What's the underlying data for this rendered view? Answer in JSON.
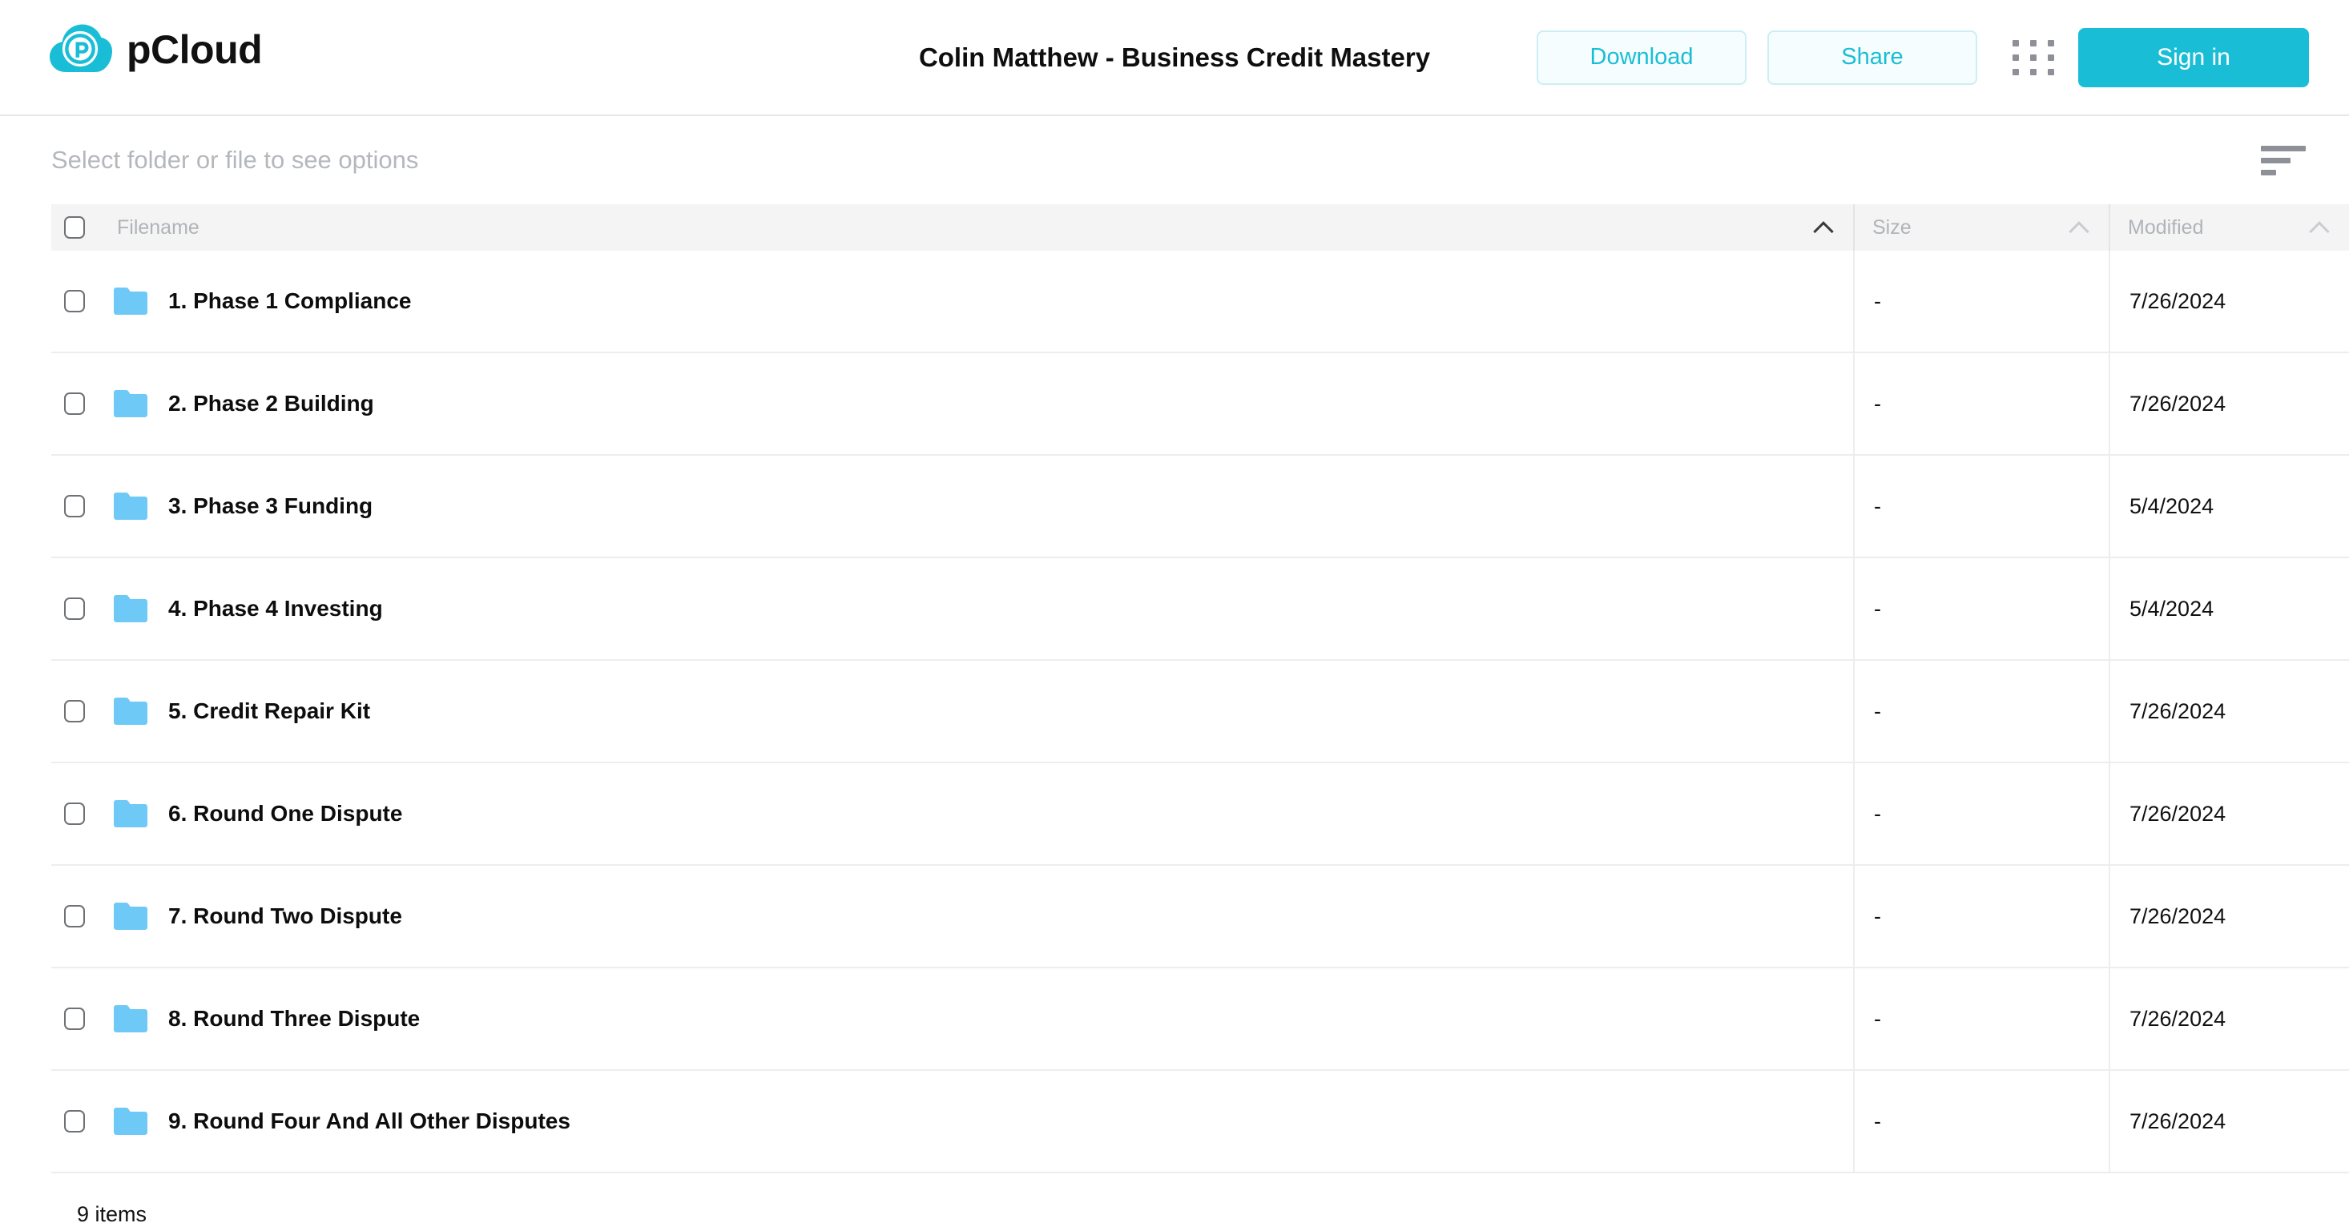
{
  "header": {
    "brand_name": "pCloud",
    "brand_logo_icon": "pcloud-cloud-logo",
    "document_title": "Colin Matthew - Business Credit Mastery",
    "download_label": "Download",
    "share_label": "Share",
    "apps_grid_icon": "apps-grid-icon",
    "signin_label": "Sign in",
    "brand_color": "#19bed6",
    "outline_border_color": "#cdeef4",
    "outline_bg_color": "#f6fdfe"
  },
  "options_bar": {
    "hint": "Select folder or file to see options",
    "sort_icon": "sort-lines-icon"
  },
  "table": {
    "columns": {
      "filename": "Filename",
      "size": "Size",
      "modified": "Modified"
    },
    "sort": {
      "active_column": "filename",
      "direction": "asc",
      "chevron_icon": "chevron-up-icon"
    },
    "select_all_checked": false,
    "rows": [
      {
        "name": "1. Phase 1 Compliance",
        "size": "-",
        "modified": "7/26/2024",
        "icon": "folder-icon",
        "checked": false
      },
      {
        "name": "2. Phase 2 Building",
        "size": "-",
        "modified": "7/26/2024",
        "icon": "folder-icon",
        "checked": false
      },
      {
        "name": "3. Phase 3 Funding",
        "size": "-",
        "modified": "5/4/2024",
        "icon": "folder-icon",
        "checked": false
      },
      {
        "name": "4. Phase 4 Investing",
        "size": "-",
        "modified": "5/4/2024",
        "icon": "folder-icon",
        "checked": false
      },
      {
        "name": "5. Credit Repair Kit",
        "size": "-",
        "modified": "7/26/2024",
        "icon": "folder-icon",
        "checked": false
      },
      {
        "name": "6. Round One Dispute",
        "size": "-",
        "modified": "7/26/2024",
        "icon": "folder-icon",
        "checked": false
      },
      {
        "name": "7. Round Two Dispute",
        "size": "-",
        "modified": "7/26/2024",
        "icon": "folder-icon",
        "checked": false
      },
      {
        "name": "8. Round Three Dispute",
        "size": "-",
        "modified": "7/26/2024",
        "icon": "folder-icon",
        "checked": false
      },
      {
        "name": "9. Round Four And All Other Disputes",
        "size": "-",
        "modified": "7/26/2024",
        "icon": "folder-icon",
        "checked": false
      }
    ]
  },
  "footer": {
    "item_count": "9 items"
  },
  "colors": {
    "folder_blue": "#6ec9f7",
    "accent_cyan": "#19bed6",
    "header_row_bg": "#f4f4f4",
    "divider": "#ededed",
    "muted_text": "#b4b7bc"
  }
}
